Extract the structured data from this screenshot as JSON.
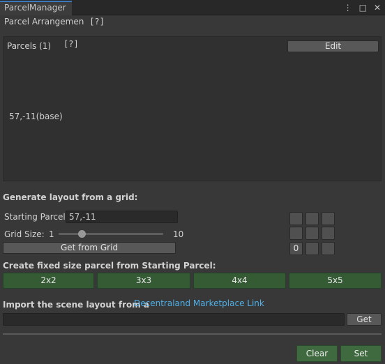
{
  "window": {
    "tab_title": "ParcelManager",
    "menu_icon": "⋮",
    "maximize_icon": "□",
    "close_icon": "✕"
  },
  "arrangement": {
    "label": "Parcel Arrangemen",
    "help": "[?]"
  },
  "parcels": {
    "header": "Parcels (1)",
    "help": "[?]",
    "edit_label": "Edit",
    "items": [
      "57,-11(base)"
    ]
  },
  "grid": {
    "section_title": "Generate layout from a grid:",
    "starting_parcel_label": "Starting Parcel",
    "starting_parcel_value": "57,-11",
    "grid_size_label": "Grid Size:",
    "grid_min": "1",
    "grid_max": "10",
    "grid_value": 3,
    "get_from_grid_label": "Get from Grid",
    "preview_cells": [
      "",
      "",
      "",
      "",
      "",
      "",
      "0",
      "",
      ""
    ]
  },
  "fixed": {
    "section_title": "Create fixed size parcel from Starting Parcel:",
    "buttons": [
      "2x2",
      "3x3",
      "4x4",
      "5x5"
    ]
  },
  "import": {
    "label": "Import the scene layout from a",
    "link_text": "Decentraland Marketplace Link",
    "input_value": "",
    "get_label": "Get"
  },
  "footer": {
    "clear_label": "Clear",
    "set_label": "Set"
  },
  "colors": {
    "accent_link": "#4fb0e8",
    "green_button": "#355b35",
    "tab_highlight": "#3a79bb"
  }
}
